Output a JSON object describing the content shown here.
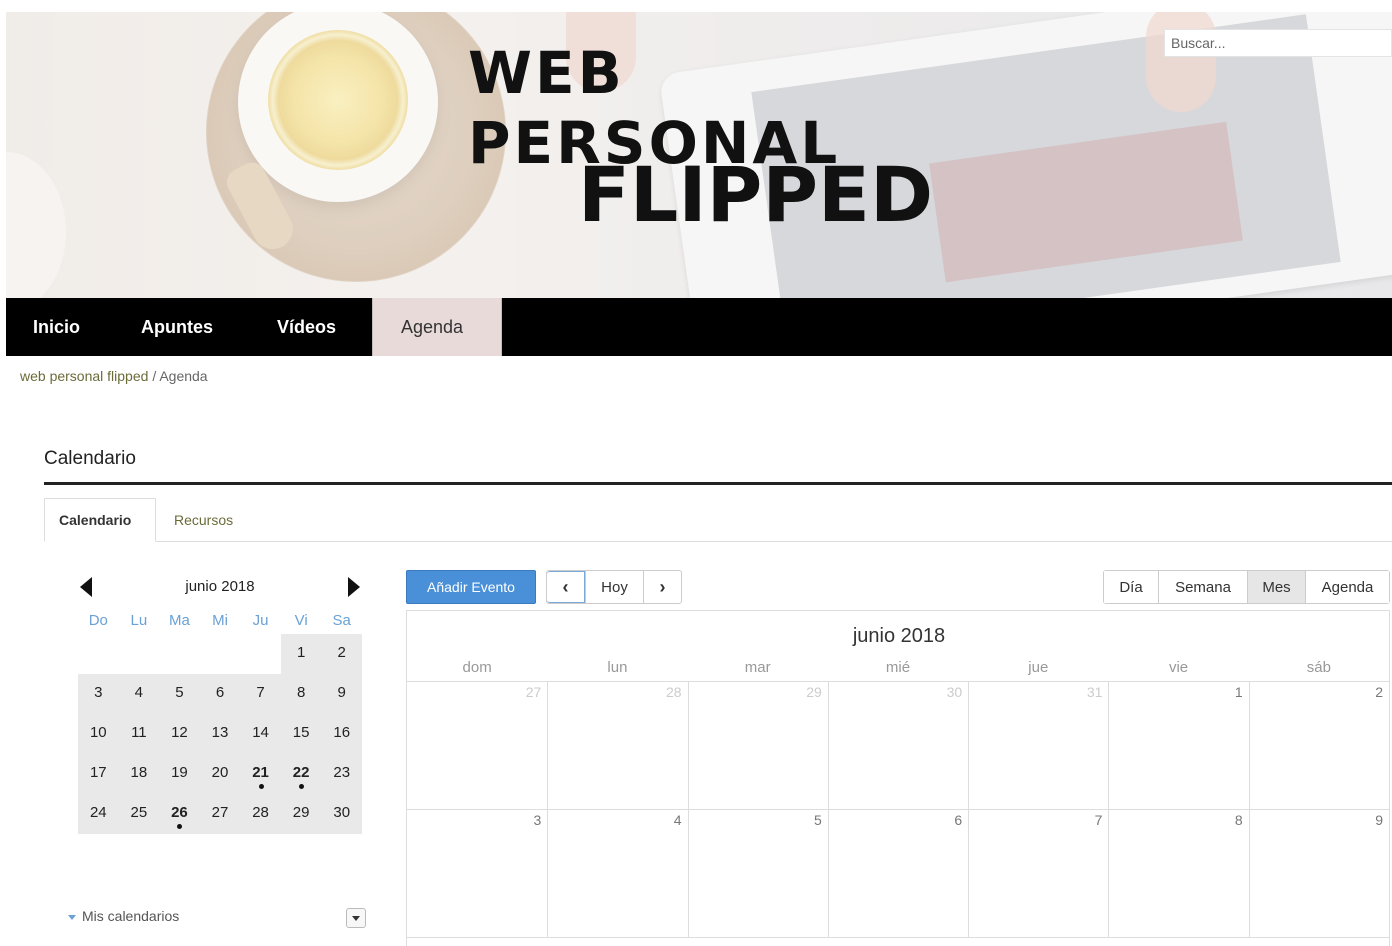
{
  "header": {
    "title_line1": "WEB PERSONAL",
    "title_line2": "FLIPPED",
    "search_placeholder": "Buscar..."
  },
  "nav": {
    "items": [
      {
        "label": "Inicio",
        "active": false
      },
      {
        "label": "Apuntes",
        "active": false
      },
      {
        "label": "Vídeos",
        "active": false
      },
      {
        "label": "Agenda",
        "active": true
      }
    ]
  },
  "breadcrumb": {
    "home": "web personal flipped",
    "separator": "/",
    "current": "Agenda"
  },
  "section": {
    "title": "Calendario"
  },
  "tabs": [
    {
      "label": "Calendario",
      "active": true
    },
    {
      "label": "Recursos",
      "active": false
    }
  ],
  "mini_calendar": {
    "title": "junio 2018",
    "dow": [
      "Do",
      "Lu",
      "Ma",
      "Mi",
      "Ju",
      "Vi",
      "Sa"
    ],
    "weeks": [
      [
        null,
        null,
        null,
        null,
        null,
        {
          "d": "1"
        },
        {
          "d": "2"
        }
      ],
      [
        {
          "d": "3"
        },
        {
          "d": "4"
        },
        {
          "d": "5"
        },
        {
          "d": "6"
        },
        {
          "d": "7"
        },
        {
          "d": "8"
        },
        {
          "d": "9"
        }
      ],
      [
        {
          "d": "10"
        },
        {
          "d": "11"
        },
        {
          "d": "12"
        },
        {
          "d": "13"
        },
        {
          "d": "14"
        },
        {
          "d": "15"
        },
        {
          "d": "16"
        }
      ],
      [
        {
          "d": "17"
        },
        {
          "d": "18"
        },
        {
          "d": "19"
        },
        {
          "d": "20"
        },
        {
          "d": "21",
          "event": true
        },
        {
          "d": "22",
          "event": true
        },
        {
          "d": "23"
        }
      ],
      [
        {
          "d": "24"
        },
        {
          "d": "25"
        },
        {
          "d": "26",
          "event": true
        },
        {
          "d": "27"
        },
        {
          "d": "28"
        },
        {
          "d": "29"
        },
        {
          "d": "30"
        }
      ]
    ],
    "my_calendars_label": "Mis calendarios"
  },
  "toolbar": {
    "add_event_label": "Añadir Evento",
    "today_label": "Hoy",
    "prev_icon": "chevron-left-icon",
    "next_icon": "chevron-right-icon",
    "views": [
      {
        "label": "Día",
        "active": false
      },
      {
        "label": "Semana",
        "active": false
      },
      {
        "label": "Mes",
        "active": true
      },
      {
        "label": "Agenda",
        "active": false
      }
    ]
  },
  "month_view": {
    "title": "junio 2018",
    "dow": [
      "dom",
      "lun",
      "mar",
      "mié",
      "jue",
      "vie",
      "sáb"
    ],
    "weeks": [
      [
        {
          "d": "27",
          "other": true
        },
        {
          "d": "28",
          "other": true
        },
        {
          "d": "29",
          "other": true
        },
        {
          "d": "30",
          "other": true
        },
        {
          "d": "31",
          "other": true
        },
        {
          "d": "1",
          "other": false
        },
        {
          "d": "2",
          "other": false
        }
      ],
      [
        {
          "d": "3",
          "other": false
        },
        {
          "d": "4",
          "other": false
        },
        {
          "d": "5",
          "other": false
        },
        {
          "d": "6",
          "other": false
        },
        {
          "d": "7",
          "other": false
        },
        {
          "d": "8",
          "other": false
        },
        {
          "d": "9",
          "other": false
        }
      ]
    ]
  },
  "colors": {
    "nav_bg": "#000000",
    "nav_active_bg": "#e9dada",
    "accent_blue": "#4a90d9",
    "link_olive": "#6b6b3a",
    "dow_blue": "#6aa1d6"
  }
}
